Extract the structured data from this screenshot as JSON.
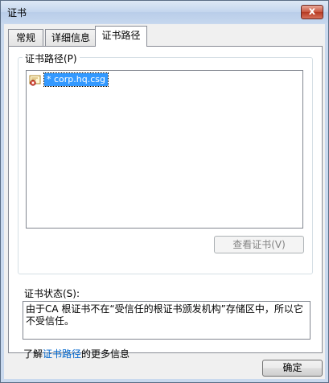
{
  "window": {
    "title": "证书",
    "close_glyph": "x"
  },
  "tabs": [
    {
      "label": "常规",
      "active": false
    },
    {
      "label": "详细信息",
      "active": false
    },
    {
      "label": "证书路径",
      "active": true
    }
  ],
  "cert_path": {
    "group_label": "证书路径(P)",
    "items": [
      {
        "label": "* corp.hq.csg",
        "icon": "certificate-error-icon"
      }
    ],
    "view_button": "查看证书(V)"
  },
  "status": {
    "label": "证书状态(S):",
    "text": "由于CA 根证书不在“受信任的根证书颁发机构”存储区中，所以它不受信任。"
  },
  "learn_more": {
    "prefix": "了解",
    "link": "证书路径",
    "suffix": "的更多信息"
  },
  "footer": {
    "ok_button": "确定"
  }
}
